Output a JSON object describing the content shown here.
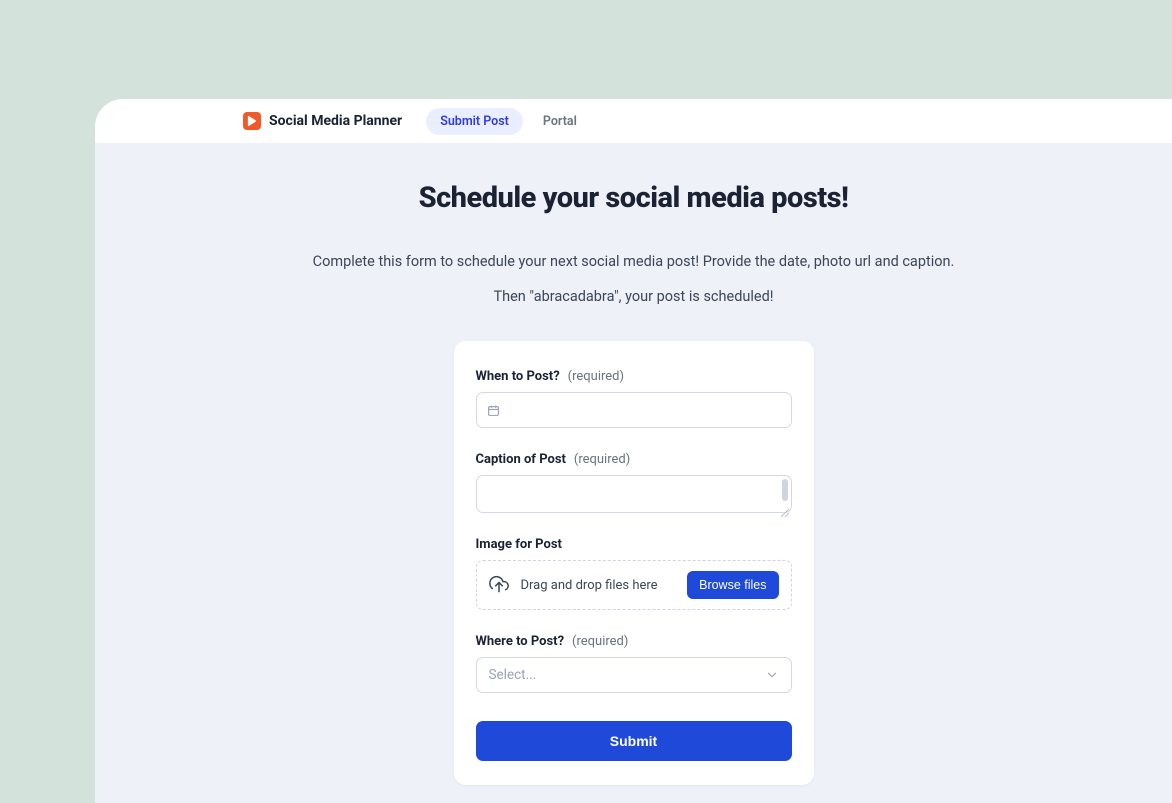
{
  "header": {
    "brand": "Social Media Planner",
    "tabs": [
      {
        "label": "Submit Post",
        "active": true
      },
      {
        "label": "Portal",
        "active": false
      }
    ]
  },
  "page": {
    "title": "Schedule your social media posts!",
    "subtitle1": "Complete this form to schedule your next social media post! Provide the date, photo url and caption.",
    "subtitle2": "Then \"abracadabra\", your post is scheduled!"
  },
  "form": {
    "when": {
      "label": "When to Post?",
      "required": "(required)",
      "value": ""
    },
    "caption": {
      "label": "Caption of Post",
      "required": "(required)",
      "value": ""
    },
    "image": {
      "label": "Image for Post",
      "drop_text": "Drag and drop files here",
      "browse_label": "Browse files"
    },
    "where": {
      "label": "Where to Post?",
      "required": "(required)",
      "placeholder": "Select..."
    },
    "submit_label": "Submit"
  }
}
